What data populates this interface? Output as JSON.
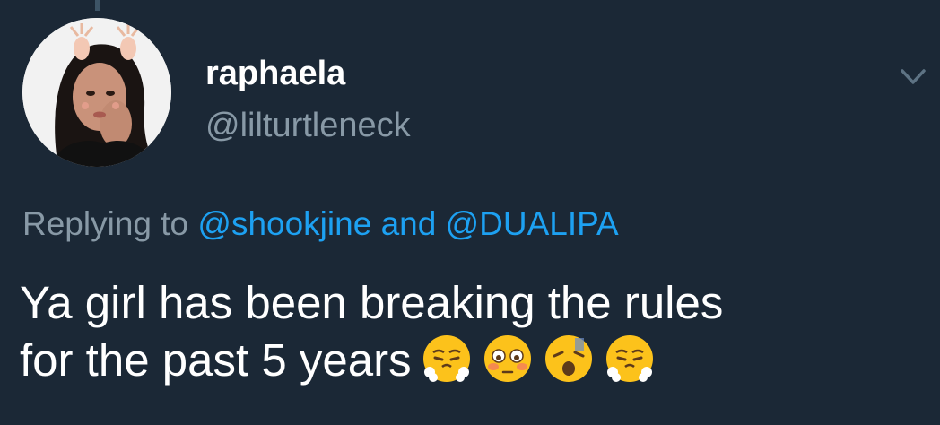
{
  "author": {
    "display_name": "raphaela",
    "handle": "@lilturtleneck"
  },
  "reply": {
    "prefix": "Replying to",
    "mention_1": "@shookjine",
    "conjunction": "and",
    "mention_2": "@DUALIPA"
  },
  "tweet": {
    "text_line_1": "Ya girl has been breaking the rules",
    "text_line_2": "for the past 5 years",
    "emojis": [
      "face-with-steam-from-nose",
      "flushed-face",
      "tired-face",
      "face-with-steam-from-nose"
    ]
  },
  "colors": {
    "background": "#1b2836",
    "primary_text": "#ffffff",
    "secondary_text": "#8899a6",
    "link": "#1da1f2"
  },
  "icons": {
    "caret": "chevron-down-icon"
  }
}
